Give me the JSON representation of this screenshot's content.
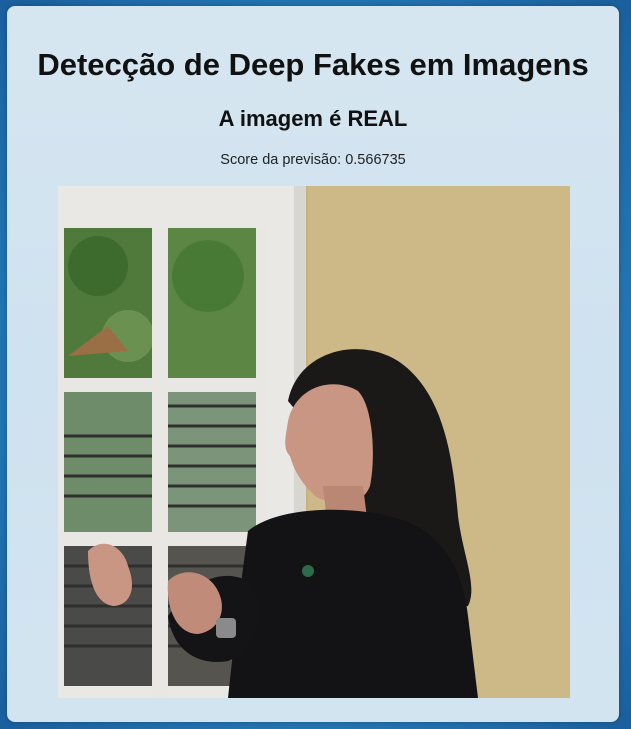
{
  "page": {
    "title": "Detecção de Deep Fakes em Imagens",
    "result_text": "A imagem é REAL",
    "score_label": "Score da previsão:",
    "score_value": "0.566735"
  },
  "image": {
    "description_icon": "uploaded-face-photo"
  },
  "colors": {
    "background_outer": "#1a5f9e",
    "background_inner": "#5ab0dc",
    "card": "#d2e4f0",
    "text": "#111111"
  }
}
